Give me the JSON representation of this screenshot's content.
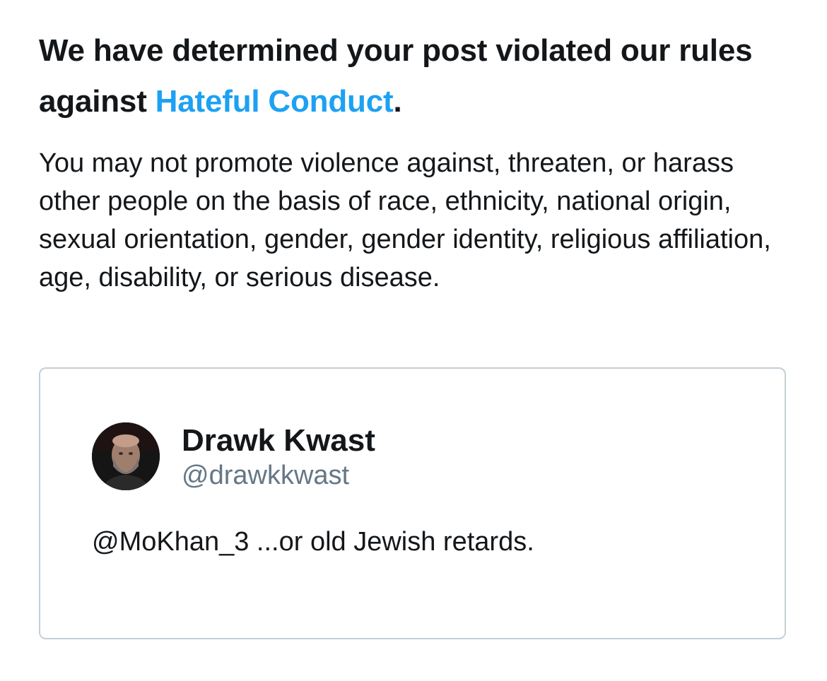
{
  "notice": {
    "heading_prefix": "We have determined your post violated our rules against ",
    "rule_link": "Hateful Conduct",
    "heading_suffix": ".",
    "body": "You may not promote violence against, threaten, or harass other people on the basis of race, ethnicity, national origin, sexual orientation, gender, gender identity, religious affiliation, age, disability, or serious disease."
  },
  "tweet": {
    "display_name": "Drawk Kwast",
    "handle": "@drawkkwast",
    "text": "@MoKhan_3 ...or old Jewish retards.",
    "avatar_icon": "user-photo-avatar"
  },
  "colors": {
    "link": "#1da1f2",
    "text": "#14171a",
    "secondary_text": "#657786",
    "card_border": "#c4cfd6"
  }
}
